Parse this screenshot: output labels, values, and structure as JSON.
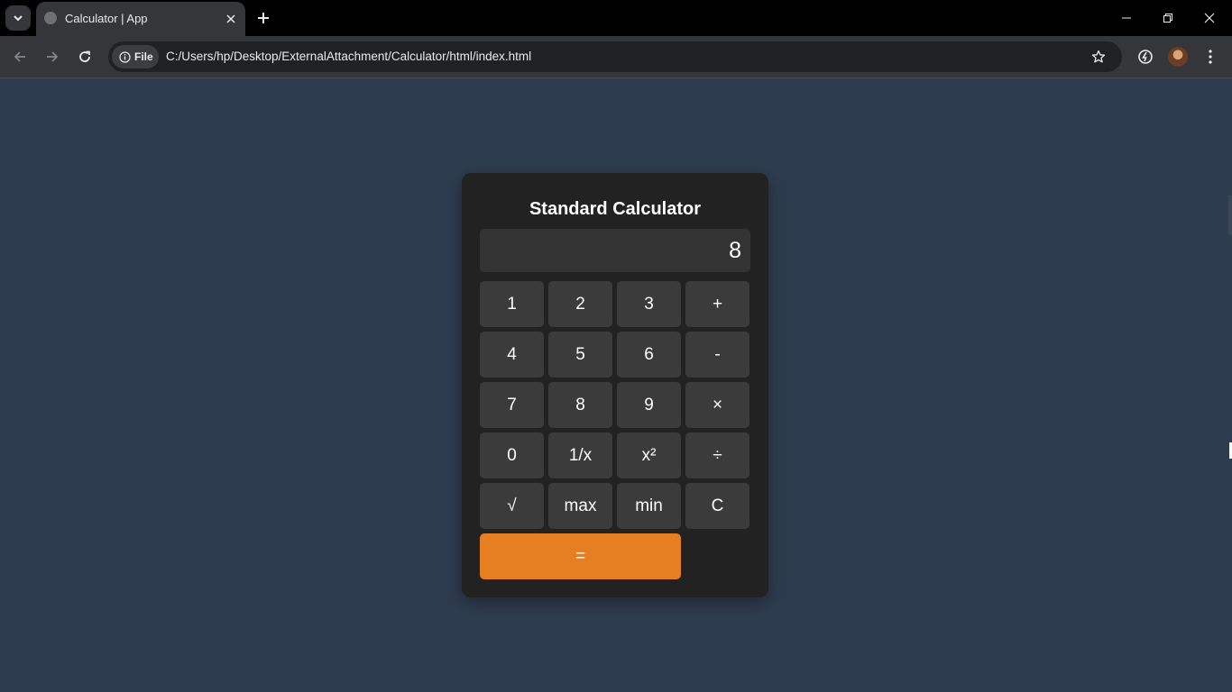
{
  "browser": {
    "tab_title": "Calculator | App",
    "security_chip_label": "File",
    "url": "C:/Users/hp/Desktop/ExternalAttachment/Calculator/html/index.html"
  },
  "calculator": {
    "title": "Standard Calculator",
    "display_value": "8",
    "keys": [
      "1",
      "2",
      "3",
      "+",
      "4",
      "5",
      "6",
      "-",
      "7",
      "8",
      "9",
      "×",
      "0",
      "1/x",
      "x²",
      "÷",
      "√",
      "max",
      "min",
      "C",
      "="
    ],
    "colors": {
      "background": "#2e3c4f",
      "panel": "#222222",
      "key": "#3b3b3b",
      "equals": "#e67e22"
    }
  }
}
